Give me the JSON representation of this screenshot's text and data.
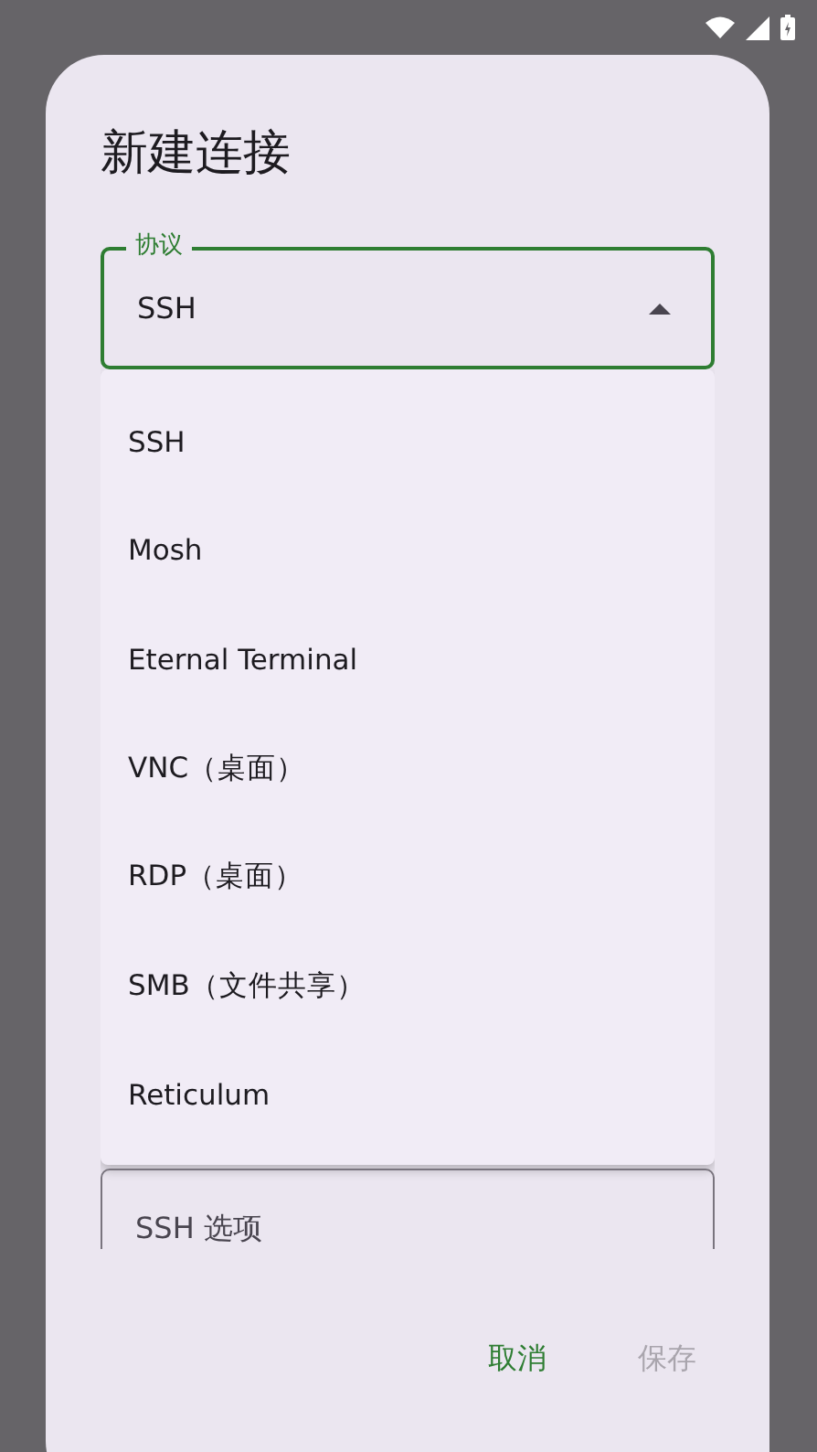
{
  "dialog": {
    "title": "新建连接",
    "protocol_field": {
      "label": "协议",
      "value": "SSH",
      "expanded": true
    },
    "menu": {
      "items": [
        {
          "label": "SSH"
        },
        {
          "label": "Mosh"
        },
        {
          "label": "Eternal Terminal"
        },
        {
          "label": "VNC（桌面）"
        },
        {
          "label": "RDP（桌面）"
        },
        {
          "label": "SMB（文件共享）"
        },
        {
          "label": "Reticulum"
        }
      ]
    },
    "options_field": {
      "label": "SSH 选项"
    },
    "buttons": [
      {
        "label": "取消",
        "disabled": false
      },
      {
        "label": "保存",
        "disabled": true
      }
    ]
  }
}
